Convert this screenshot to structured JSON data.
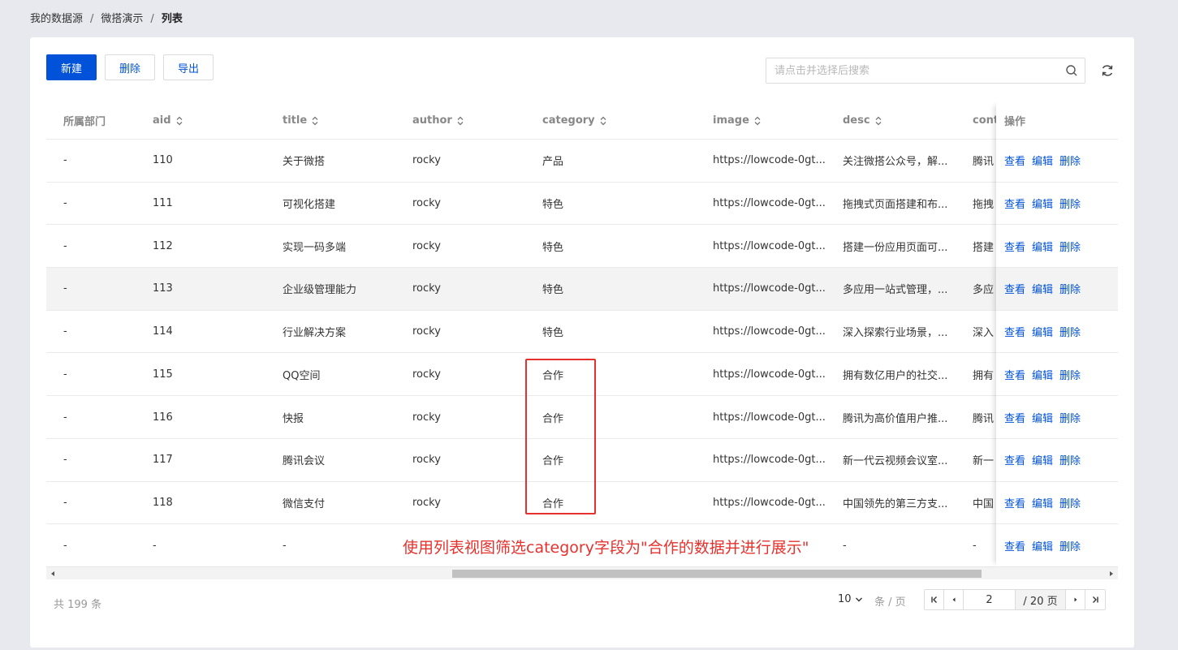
{
  "breadcrumb": {
    "items": [
      "我的数据源",
      "微搭演示"
    ],
    "current": "列表",
    "separator": "/"
  },
  "toolbar": {
    "new_label": "新建",
    "delete_label": "删除",
    "export_label": "导出"
  },
  "search": {
    "placeholder": "请点击并选择后搜索"
  },
  "table": {
    "columns": {
      "dept": "所属部门",
      "aid": "aid",
      "title": "title",
      "author": "author",
      "category": "category",
      "image": "image",
      "desc": "desc",
      "content": "cont",
      "ops": "操作"
    },
    "op_labels": {
      "view": "查看",
      "edit": "编辑",
      "delete": "删除"
    },
    "rows": [
      {
        "dept": "-",
        "aid": "110",
        "title": "关于微搭",
        "author": "rocky",
        "category": "产品",
        "image": "https://lowcode-0gt...",
        "desc": "关注微搭公众号，解...",
        "content": "腾讯"
      },
      {
        "dept": "-",
        "aid": "111",
        "title": "可视化搭建",
        "author": "rocky",
        "category": "特色",
        "image": "https://lowcode-0gt...",
        "desc": "拖拽式页面搭建和布...",
        "content": "拖拽"
      },
      {
        "dept": "-",
        "aid": "112",
        "title": "实现一码多端",
        "author": "rocky",
        "category": "特色",
        "image": "https://lowcode-0gt...",
        "desc": "搭建一份应用页面可...",
        "content": "搭建"
      },
      {
        "dept": "-",
        "aid": "113",
        "title": "企业级管理能力",
        "author": "rocky",
        "category": "特色",
        "image": "https://lowcode-0gt...",
        "desc": "多应用一站式管理，...",
        "content": "多应"
      },
      {
        "dept": "-",
        "aid": "114",
        "title": "行业解决方案",
        "author": "rocky",
        "category": "特色",
        "image": "https://lowcode-0gt...",
        "desc": "深入探索行业场景，...",
        "content": "深入"
      },
      {
        "dept": "-",
        "aid": "115",
        "title": "QQ空间",
        "author": "rocky",
        "category": "合作",
        "image": "https://lowcode-0gt...",
        "desc": "拥有数亿用户的社交...",
        "content": "拥有"
      },
      {
        "dept": "-",
        "aid": "116",
        "title": "快报",
        "author": "rocky",
        "category": "合作",
        "image": "https://lowcode-0gt...",
        "desc": "腾讯为高价值用户推...",
        "content": "腾讯"
      },
      {
        "dept": "-",
        "aid": "117",
        "title": "腾讯会议",
        "author": "rocky",
        "category": "合作",
        "image": "https://lowcode-0gt...",
        "desc": "新一代云视频会议室...",
        "content": "新一"
      },
      {
        "dept": "-",
        "aid": "118",
        "title": "微信支付",
        "author": "rocky",
        "category": "合作",
        "image": "https://lowcode-0gt...",
        "desc": "中国领先的第三方支...",
        "content": "中国"
      },
      {
        "dept": "-",
        "aid": "-",
        "title": "-",
        "author": "",
        "category": "",
        "image": "",
        "desc": "-",
        "content": "-"
      }
    ]
  },
  "pagination": {
    "total_text": "共  199  条",
    "page_size": "10",
    "page_size_unit": "条 / 页",
    "current_page": "2",
    "total_pages": "/ 20 页"
  },
  "annotation": {
    "text": "使用列表视图筛选category字段为\"合作的数据并进行展示\""
  },
  "colors": {
    "accent": "#0052d9",
    "annotation": "#e5322d"
  }
}
